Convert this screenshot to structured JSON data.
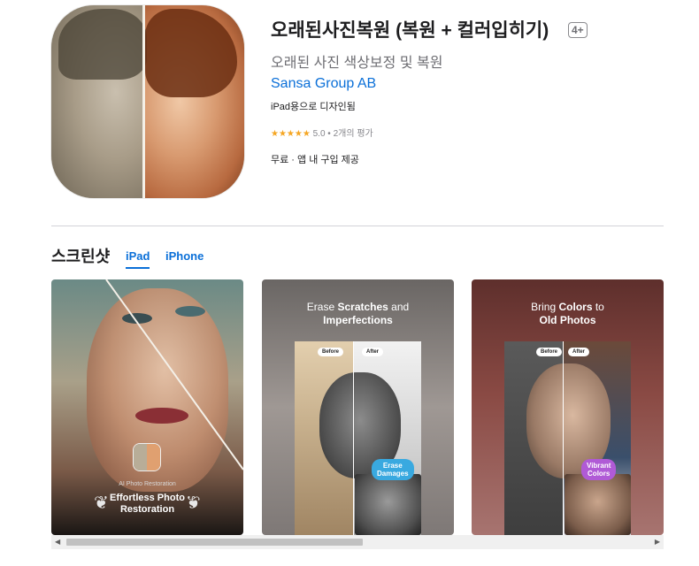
{
  "app": {
    "title": "오래된사진복원 (복원 + 컬러입히기)",
    "age_rating": "4+",
    "subtitle": "오래된 사진 색상보정 및 복원",
    "developer": "Sansa Group AB",
    "device_note": "iPad용으로 디자인됨",
    "stars": "★★★★★",
    "rating": "5.0",
    "rating_count": "2개의 평가",
    "price": "무료 · 앱 내 구입 제공"
  },
  "screenshots_section": {
    "title": "스크린샷",
    "tabs": [
      {
        "label": "iPad",
        "active": true
      },
      {
        "label": "iPhone",
        "active": false
      }
    ]
  },
  "screenshots": [
    {
      "small_caption": "AI Photo Restoration",
      "big_caption_line1": "Effortless Photo",
      "big_caption_line2": "Restoration"
    },
    {
      "head_line1_a": "Erase ",
      "head_line1_b": "Scratches",
      "head_line1_c": " and",
      "head_line2": "Imperfections",
      "before": "Before",
      "after": "After",
      "bubble_line1": "Erase",
      "bubble_line2": "Damages"
    },
    {
      "head_line1_a": "Bring ",
      "head_line1_b": "Colors",
      "head_line1_c": " to",
      "head_line2": "Old Photos",
      "before": "Before",
      "after": "After",
      "bubble_line1": "Vibrant",
      "bubble_line2": "Colors"
    }
  ],
  "scrollbar": {
    "left_arrow": "◀",
    "right_arrow": "▶",
    "position": 0.0
  },
  "colors": {
    "link": "#0a6fd8",
    "star": "#f5a623"
  }
}
